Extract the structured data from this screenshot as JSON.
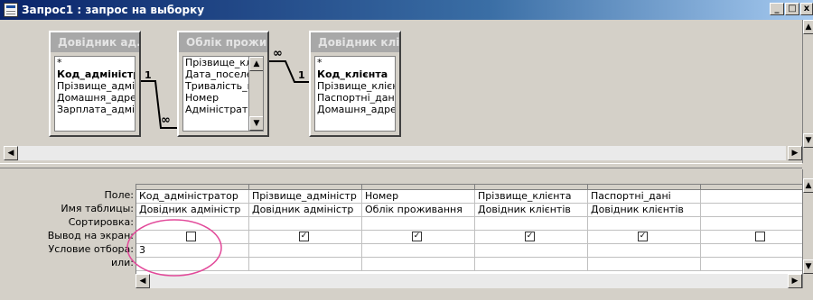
{
  "window": {
    "title": "Запрос1 : запрос на выборку",
    "min_label": "_",
    "max_label": "□",
    "close_label": "x"
  },
  "tables": [
    {
      "title": "Довідник ад...",
      "fields": [
        "*",
        "Код_адміністрат",
        "Прізвище_адміні",
        "Домашня_адрес",
        "Зарплата_адміні"
      ]
    },
    {
      "title": "Облік прожи...",
      "fields": [
        "Прізвище_клі",
        "Дата_поселе",
        "Тривалість_п",
        "Номер",
        "Адміністрато"
      ]
    },
    {
      "title": "Довідник клі...",
      "fields": [
        "*",
        "Код_клієнта",
        "Прізвище_клієнт",
        "Паспортні_дані",
        "Домашня_адрес"
      ]
    }
  ],
  "relations": [
    {
      "left_label": "1",
      "right_label": "∞"
    },
    {
      "left_label": "∞",
      "right_label": "1"
    }
  ],
  "grid": {
    "row_labels": [
      "Поле:",
      "Имя таблицы:",
      "Сортировка:",
      "Вывод на экран:",
      "Условие отбора:",
      "или:"
    ],
    "columns": [
      {
        "field": "Код_адміністратор",
        "table": "Довідник адміністр",
        "sort": "",
        "show": false,
        "criteria": "3",
        "or": ""
      },
      {
        "field": "Прізвище_адміністр",
        "table": "Довідник адміністр",
        "sort": "",
        "show": true,
        "criteria": "",
        "or": ""
      },
      {
        "field": "Номер",
        "table": "Облік проживання",
        "sort": "",
        "show": true,
        "criteria": "",
        "or": ""
      },
      {
        "field": "Прізвище_клієнта",
        "table": "Довідник клієнтів",
        "sort": "",
        "show": true,
        "criteria": "",
        "or": ""
      },
      {
        "field": "Паспортні_дані",
        "table": "Довідник клієнтів",
        "sort": "",
        "show": true,
        "criteria": "",
        "or": ""
      },
      {
        "field": "",
        "table": "",
        "sort": "",
        "show": false,
        "criteria": "",
        "or": ""
      }
    ]
  },
  "colors": {
    "titlebar": "#0a246a",
    "highlight_ellipse": "#e24a9a",
    "window_bg": "#d4d0c8"
  }
}
